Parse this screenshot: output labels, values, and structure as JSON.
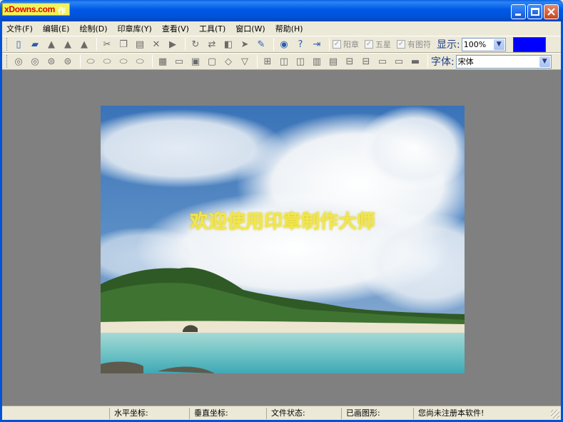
{
  "window": {
    "title": "",
    "logo_text": "xDowns.com",
    "logo_suffix": "作"
  },
  "menu": [
    {
      "label": "文件(F)"
    },
    {
      "label": "编辑(E)"
    },
    {
      "label": "绘制(D)"
    },
    {
      "label": "印章库(Y)"
    },
    {
      "label": "查看(V)"
    },
    {
      "label": "工具(T)"
    },
    {
      "label": "窗口(W)"
    },
    {
      "label": "帮助(H)"
    }
  ],
  "toolbar1": {
    "checkboxes": [
      {
        "label": "阳章",
        "checked": true
      },
      {
        "label": "五星",
        "checked": true
      },
      {
        "label": "有图符",
        "checked": true
      }
    ],
    "zoom_label": "显示:",
    "zoom_value": "100%",
    "color_value": "#0000ff"
  },
  "toolbar2": {
    "font_label": "字体:",
    "font_value": "宋体"
  },
  "canvas": {
    "overlay_text": "欢迎使用印章制作大师",
    "text_color": "#f3e64a"
  },
  "status": {
    "x_label": "水平坐标:",
    "y_label": "垂直坐标:",
    "file_state_label": "文件状态:",
    "drawn_shape_label": "已画图形:",
    "register_text": "您尚未注册本软件!"
  }
}
